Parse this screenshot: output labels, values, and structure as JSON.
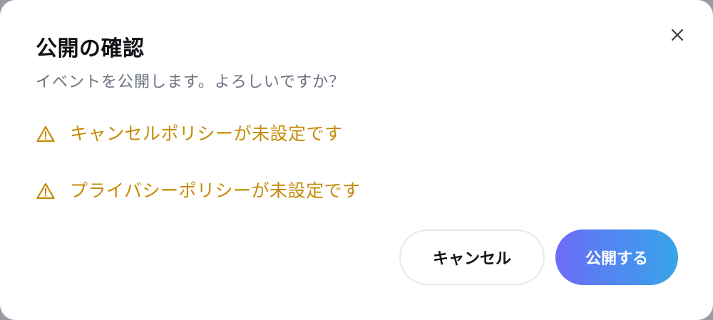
{
  "dialog": {
    "title": "公開の確認",
    "subtitle": "イベントを公開します。よろしいですか？",
    "close_icon": "close-icon",
    "warnings": [
      {
        "icon": "warning-icon",
        "text": "キャンセルポリシーが未設定です"
      },
      {
        "icon": "warning-icon",
        "text": "プライバシーポリシーが未設定です"
      }
    ],
    "buttons": {
      "cancel_label": "キャンセル",
      "publish_label": "公開する"
    }
  },
  "colors": {
    "warning": "#c58a06",
    "title": "#0f1115",
    "subtitle": "#6b7280",
    "primary_gradient_start": "#6b6cf6",
    "primary_gradient_end": "#39a5e8"
  }
}
